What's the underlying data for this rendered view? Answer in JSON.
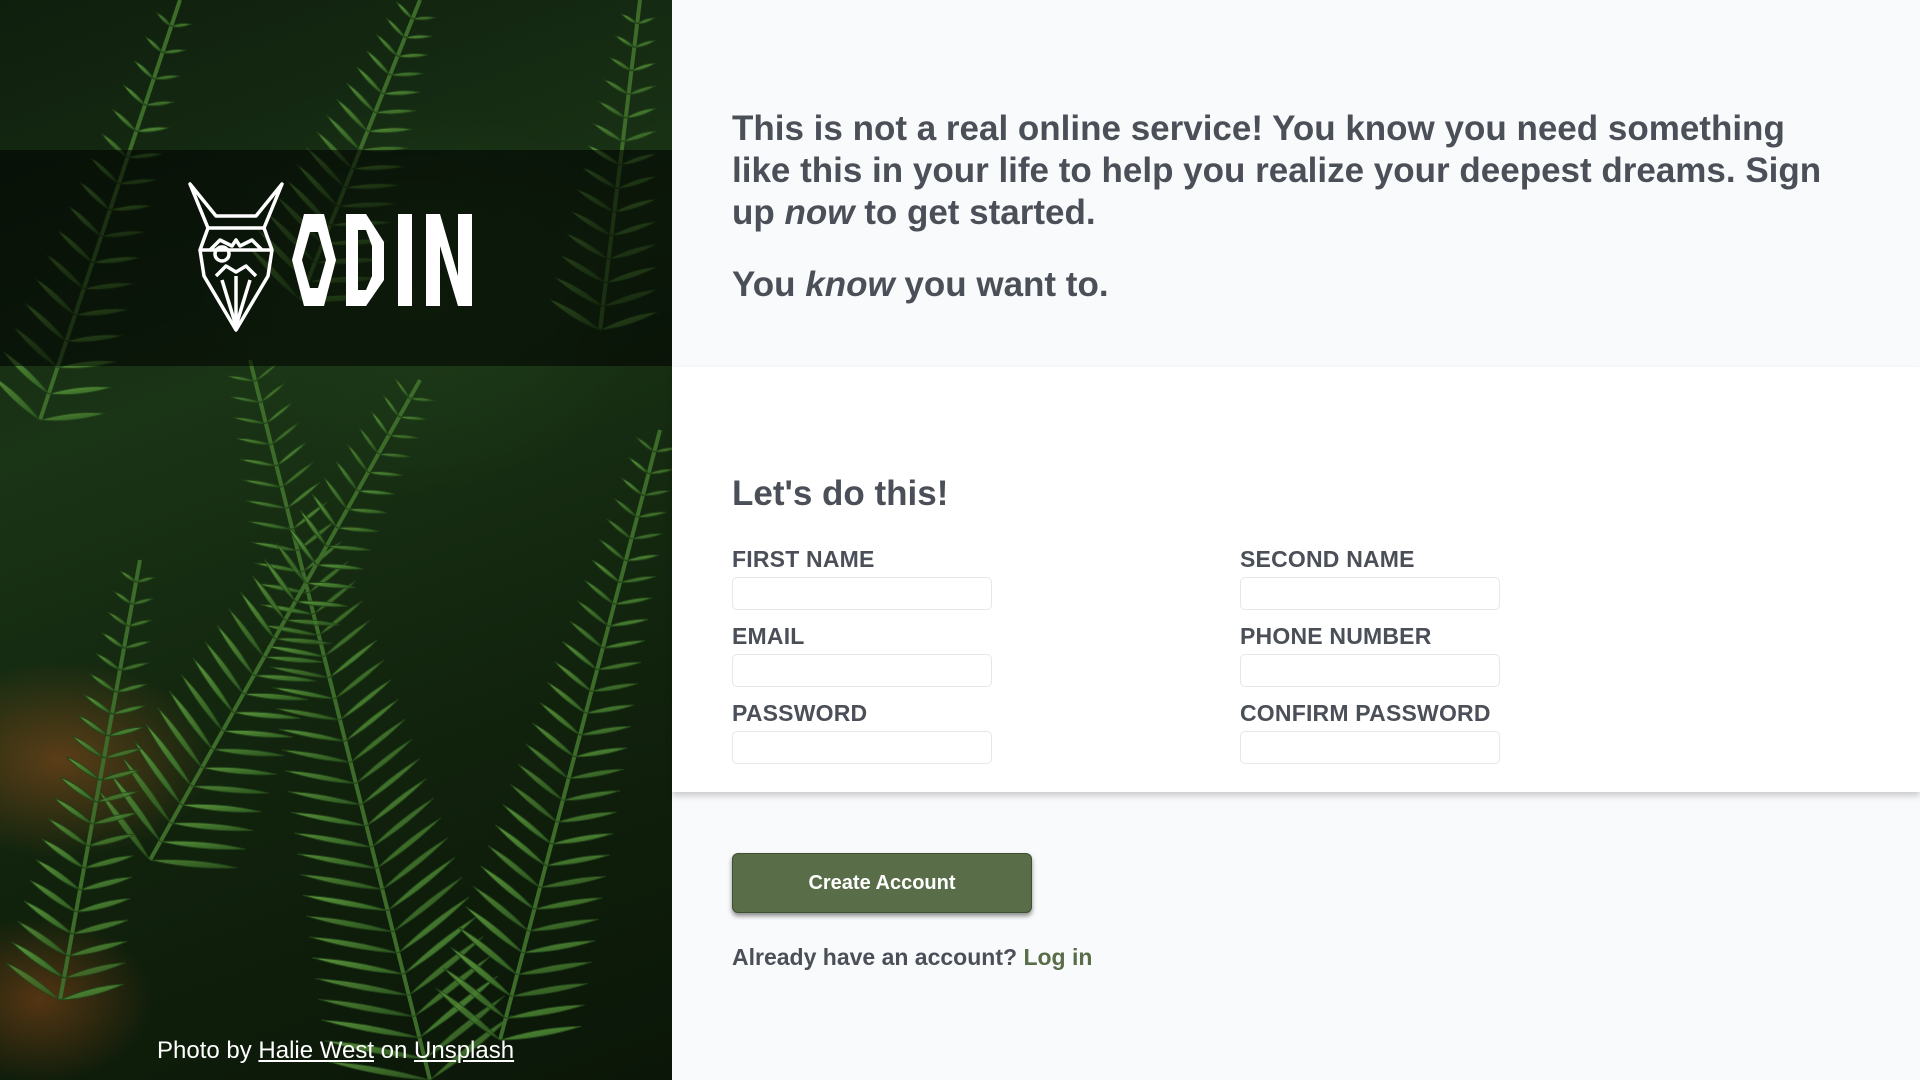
{
  "brand": {
    "logo_text": "ODIN",
    "logo_icon": "viking-helmet-icon"
  },
  "photo_credit": {
    "prefix": "Photo by ",
    "author": "Halie West",
    "middle": " on ",
    "source": "Unsplash"
  },
  "intro": {
    "line1_before": "This is not a real online service! You know you need something like this in your life to help you realize your deepest dreams. Sign up ",
    "line1_emphasis": "now",
    "line1_after": " to get started.",
    "line2_before": "You ",
    "line2_emphasis": "know",
    "line2_after": " you want to."
  },
  "form": {
    "title": "Let's do this!",
    "fields": {
      "first_name": {
        "label": "FIRST NAME",
        "value": ""
      },
      "second_name": {
        "label": "SECOND NAME",
        "value": ""
      },
      "email": {
        "label": "EMAIL",
        "value": ""
      },
      "phone": {
        "label": "PHONE NUMBER",
        "value": ""
      },
      "password": {
        "label": "PASSWORD",
        "value": ""
      },
      "confirm_password": {
        "label": "CONFIRM PASSWORD",
        "value": ""
      }
    }
  },
  "actions": {
    "create_account_label": "Create Account",
    "login_prompt": "Already have an account?",
    "login_link": "Log in"
  },
  "colors": {
    "accent_green": "#596d48",
    "text_gray": "#4b4f58",
    "page_background": "#f9fafb",
    "card_background": "#ffffff"
  }
}
